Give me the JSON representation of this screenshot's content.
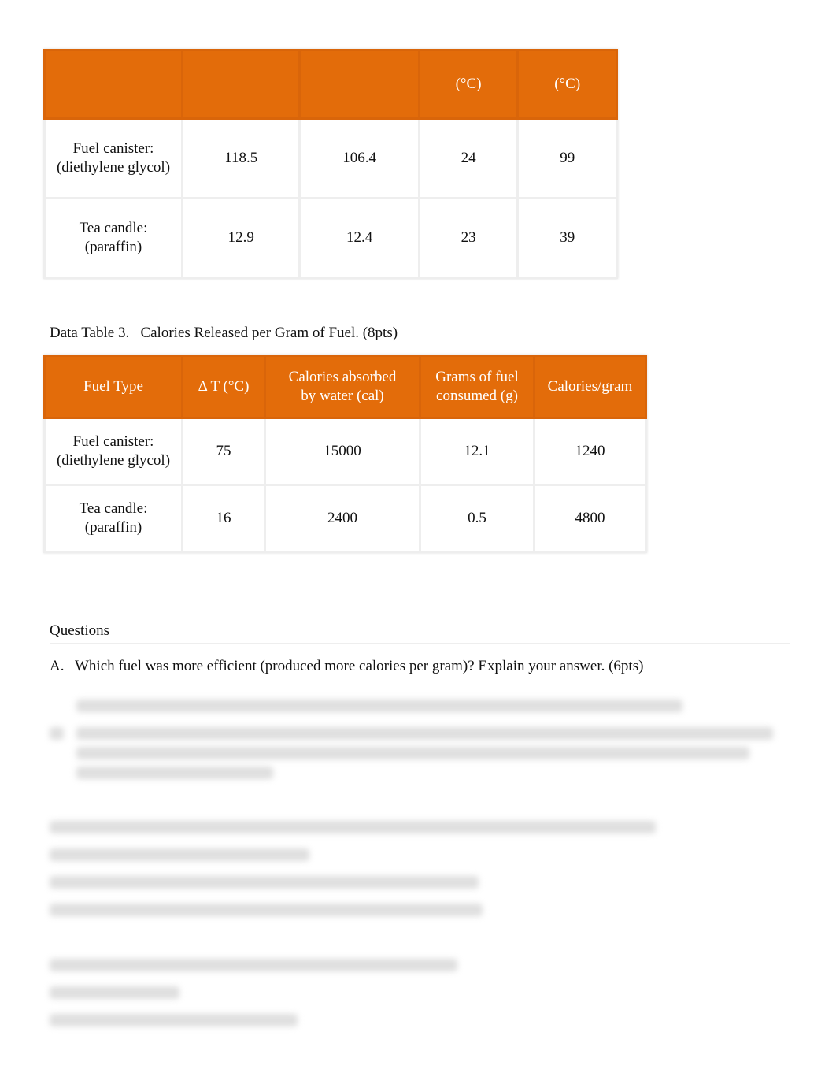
{
  "table1": {
    "headers": [
      "",
      "",
      "",
      "(°C)",
      "(°C)"
    ],
    "rows": [
      [
        "Fuel canister: (diethylene glycol)",
        "118.5",
        "106.4",
        "24",
        "99"
      ],
      [
        "Tea candle: (paraffin)",
        "12.9",
        "12.4",
        "23",
        "39"
      ]
    ]
  },
  "table3": {
    "caption": "Data Table 3.   Calories Released per Gram of Fuel. (8pts)",
    "headers": [
      "Fuel Type",
      "Δ T (°C)",
      "Calories absorbed by water (cal)",
      "Grams of fuel consumed (g)",
      "Calories/gram"
    ],
    "rows": [
      [
        "Fuel canister: (diethylene glycol)",
        "75",
        "15000",
        "12.1",
        "1240"
      ],
      [
        "Tea candle: (paraffin)",
        "16",
        "2400",
        "0.5",
        "4800"
      ]
    ]
  },
  "questions": {
    "heading": "Questions",
    "a_label": "A.",
    "a_text": "Which fuel was more efficient (produced more calories per gram)? Explain your answer. (6pts)"
  },
  "colors": {
    "header_orange": "#E36C0A"
  }
}
